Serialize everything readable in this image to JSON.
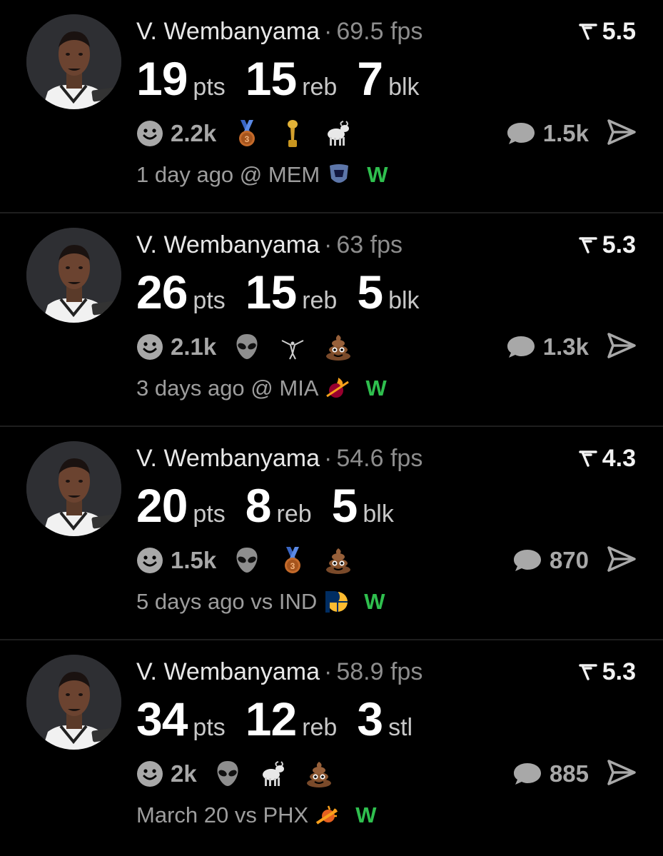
{
  "posts": [
    {
      "player": "V. Wembanyama",
      "fps": "69.5 fps",
      "score": "5.5",
      "stats": [
        {
          "value": "19",
          "unit": "pts"
        },
        {
          "value": "15",
          "unit": "reb"
        },
        {
          "value": "7",
          "unit": "blk"
        }
      ],
      "reaction_count": "2.2k",
      "emojis": [
        "bronze-medal",
        "trophy",
        "goat"
      ],
      "comments": "1.5k",
      "time": "1 day ago @ MEM",
      "team_logo": "grizzlies-logo",
      "result": "W"
    },
    {
      "player": "V. Wembanyama",
      "fps": "63 fps",
      "score": "5.3",
      "stats": [
        {
          "value": "26",
          "unit": "pts"
        },
        {
          "value": "15",
          "unit": "reb"
        },
        {
          "value": "5",
          "unit": "blk"
        }
      ],
      "reaction_count": "2.1k",
      "emojis": [
        "alien",
        "dunk",
        "poop"
      ],
      "comments": "1.3k",
      "time": "3 days ago @ MIA",
      "team_logo": "heat-logo",
      "result": "W"
    },
    {
      "player": "V. Wembanyama",
      "fps": "54.6 fps",
      "score": "4.3",
      "stats": [
        {
          "value": "20",
          "unit": "pts"
        },
        {
          "value": "8",
          "unit": "reb"
        },
        {
          "value": "5",
          "unit": "blk"
        }
      ],
      "reaction_count": "1.5k",
      "emojis": [
        "alien",
        "bronze-medal",
        "poop"
      ],
      "comments": "870",
      "time": "5 days ago vs IND",
      "team_logo": "pacers-logo",
      "result": "W"
    },
    {
      "player": "V. Wembanyama",
      "fps": "58.9 fps",
      "score": "5.3",
      "stats": [
        {
          "value": "34",
          "unit": "pts"
        },
        {
          "value": "12",
          "unit": "reb"
        },
        {
          "value": "3",
          "unit": "stl"
        }
      ],
      "reaction_count": "2k",
      "emojis": [
        "alien",
        "goat",
        "poop"
      ],
      "comments": "885",
      "time": "March 20 vs PHX",
      "team_logo": "suns-logo",
      "result": "W"
    }
  ],
  "colors": {
    "background": "#000000",
    "muted": "#9d9d9d",
    "win": "#2fbf4e",
    "divider": "#1e1e1e"
  },
  "icons": {
    "score": "trending-score-icon",
    "reaction": "smile-icon",
    "comment": "comment-bubble-icon",
    "share": "send-icon"
  }
}
